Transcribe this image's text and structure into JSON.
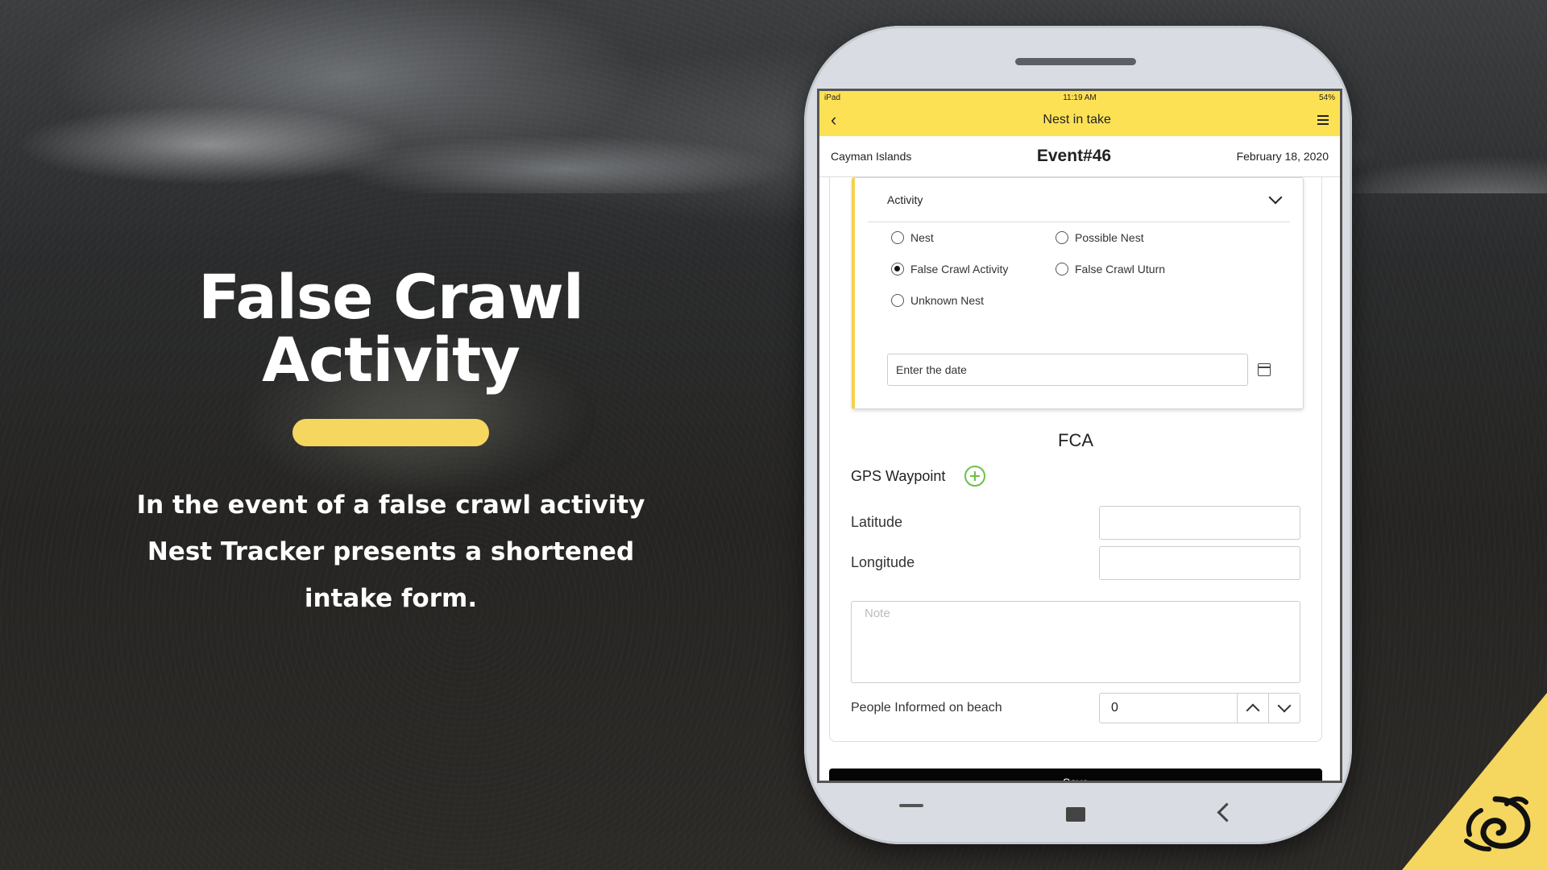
{
  "slide": {
    "headline_line1": "False Crawl",
    "headline_line2": "Activity",
    "description_line1": "In the event of a false crawl activity",
    "description_line2": "Nest Tracker presents a shortened",
    "description_line3": "intake form.",
    "accent_color": "#f5d65f"
  },
  "status_bar": {
    "device": "iPad",
    "time": "11:19 AM",
    "battery": "54%"
  },
  "app_bar": {
    "title": "Nest in take",
    "back_icon": "chevron-left-icon",
    "menu_icon": "hamburger-menu-icon",
    "bar_color": "#fde155"
  },
  "event_header": {
    "location": "Cayman Islands",
    "event_title": "Event#46",
    "date": "February 18, 2020"
  },
  "activity": {
    "section_label": "Activity",
    "options": [
      {
        "label": "Nest",
        "checked": false
      },
      {
        "label": "Possible Nest",
        "checked": false
      },
      {
        "label": "False Crawl Activity",
        "checked": true
      },
      {
        "label": "False Crawl Uturn",
        "checked": false
      },
      {
        "label": "Unknown Nest",
        "checked": false
      }
    ],
    "date_placeholder": "Enter the date"
  },
  "fca": {
    "heading": "FCA",
    "gps_label": "GPS Waypoint",
    "latitude_label": "Latitude",
    "longitude_label": "Longitude",
    "note_placeholder": "Note",
    "people_label": "People Informed on beach",
    "people_value": "0"
  },
  "actions": {
    "save_label": "Save"
  }
}
